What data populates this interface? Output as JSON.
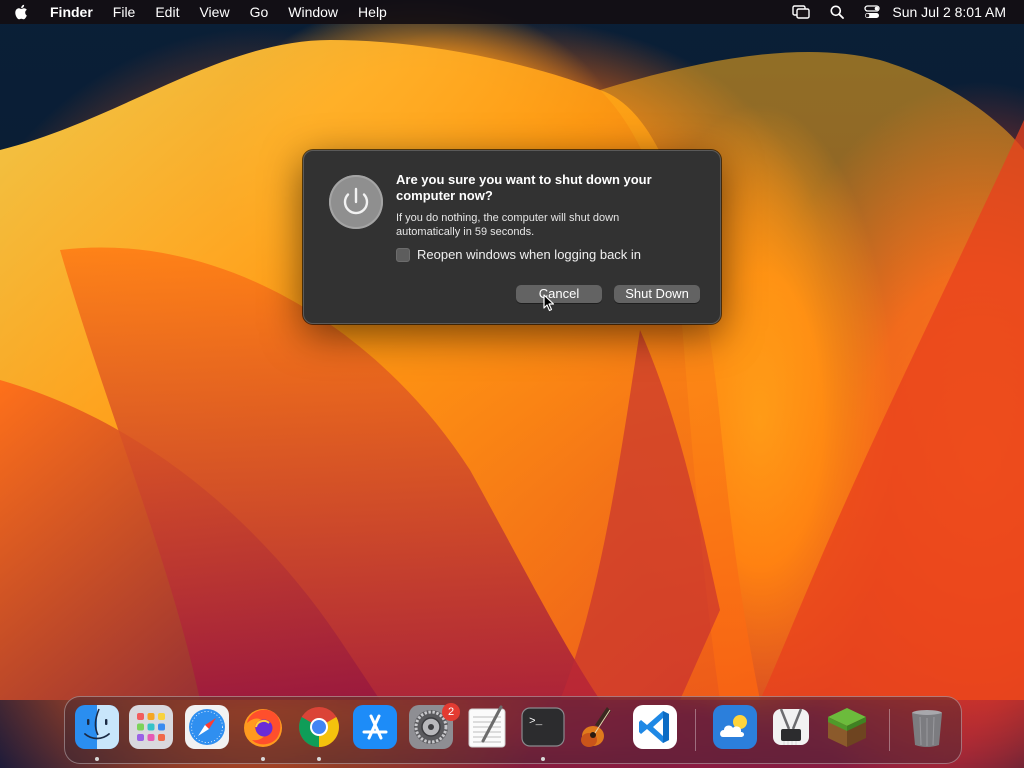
{
  "menubar": {
    "apple": "apple-icon",
    "app_name": "Finder",
    "menus": [
      "File",
      "Edit",
      "View",
      "Go",
      "Window",
      "Help"
    ],
    "clock": "Sun Jul 2  8:01 AM",
    "status_icons": [
      "screen-mirroring-icon",
      "search-icon",
      "control-center-icon"
    ]
  },
  "dialog": {
    "icon": "power-icon",
    "title": "Are you sure you want to shut down your computer now?",
    "message": "If you do nothing, the computer will shut down automatically in 59 seconds.",
    "checkbox_label": "Reopen windows when logging back in",
    "checkbox_checked": false,
    "cancel_label": "Cancel",
    "shutdown_label": "Shut Down"
  },
  "dock": {
    "apps": [
      {
        "name": "Finder",
        "icon": "finder-icon",
        "running": true
      },
      {
        "name": "Launchpad",
        "icon": "launchpad-icon",
        "running": false
      },
      {
        "name": "Safari",
        "icon": "safari-icon",
        "running": false
      },
      {
        "name": "Firefox",
        "icon": "firefox-icon",
        "running": true
      },
      {
        "name": "Chrome",
        "icon": "chrome-icon",
        "running": true
      },
      {
        "name": "App Store",
        "icon": "app-store-icon",
        "running": false
      },
      {
        "name": "System Settings",
        "icon": "settings-icon",
        "running": false,
        "badge": "2"
      },
      {
        "name": "TextEdit",
        "icon": "textedit-icon",
        "running": false
      },
      {
        "name": "Terminal",
        "icon": "terminal-icon",
        "running": true
      },
      {
        "name": "GarageBand",
        "icon": "garageband-icon",
        "running": false
      },
      {
        "name": "Visual Studio Code",
        "icon": "vscode-icon",
        "running": false
      },
      {
        "name": "Weather",
        "icon": "weather-icon",
        "running": false
      },
      {
        "name": "System Information",
        "icon": "system-info-icon",
        "running": false
      },
      {
        "name": "Minecraft",
        "icon": "minecraft-icon",
        "running": false
      },
      {
        "name": "Trash",
        "icon": "trash-icon",
        "running": false
      }
    ]
  },
  "colors": {
    "dialog_bg": "#323232",
    "button_bg": "#636363",
    "badge": "#e33b32"
  }
}
